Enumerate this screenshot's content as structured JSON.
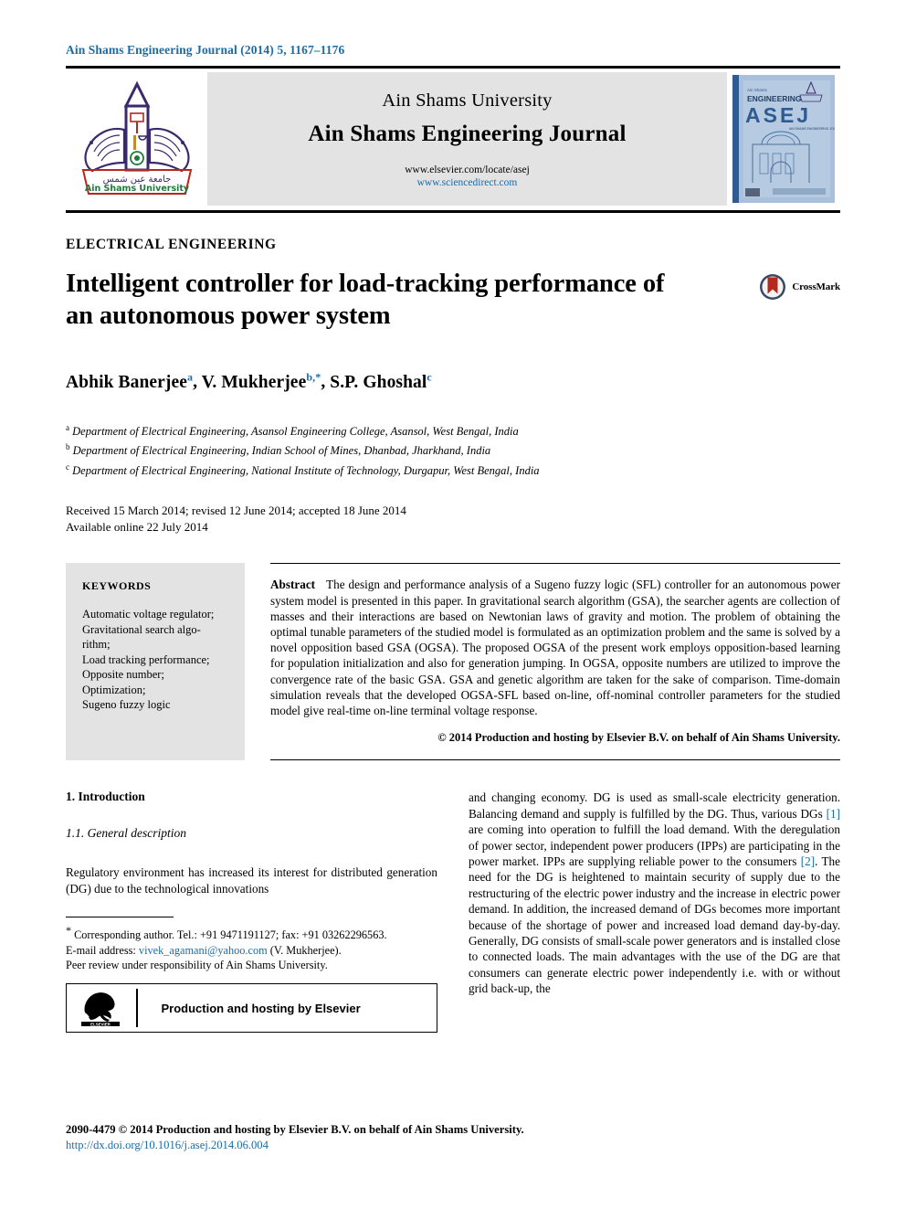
{
  "running_head": "Ain Shams Engineering Journal (2014) 5, 1167–1176",
  "masthead": {
    "university": "Ain Shams University",
    "journal": "Ain Shams Engineering Journal",
    "url_locate": "www.elsevier.com/locate/asej",
    "url_sciencedirect": "www.sciencedirect.com",
    "logo_caption_arabic": "جامعة عين شمس",
    "logo_caption": "Ain Shams University",
    "cover": {
      "top_label": "Ain Shams",
      "subject": "ENGINEERING",
      "acronym": "ASEJ",
      "acronym_sub": "AIN SHAMS ENGINEERING JOURNAL"
    }
  },
  "article": {
    "section_label": "ELECTRICAL ENGINEERING",
    "title": "Intelligent controller for load-tracking performance of an autonomous power system",
    "crossmark_label": "CrossMark",
    "authors": [
      {
        "name": "Abhik Banerjee",
        "sup": "a",
        "sep": ", "
      },
      {
        "name": "V. Mukherjee",
        "sup": "b,*",
        "sep": ", "
      },
      {
        "name": "S.P. Ghoshal",
        "sup": "c",
        "sep": ""
      }
    ],
    "affiliations": [
      {
        "marker": "a",
        "text": "Department of Electrical Engineering, Asansol Engineering College, Asansol, West Bengal, India"
      },
      {
        "marker": "b",
        "text": "Department of Electrical Engineering, Indian School of Mines, Dhanbad, Jharkhand, India"
      },
      {
        "marker": "c",
        "text": "Department of Electrical Engineering, National Institute of Technology, Durgapur, West Bengal, India"
      }
    ],
    "history_line1": "Received 15 March 2014; revised 12 June 2014; accepted 18 June 2014",
    "history_line2": "Available online 22 July 2014"
  },
  "keywords": {
    "heading": "KEYWORDS",
    "items": [
      "Automatic voltage regulator;",
      "Gravitational search algo-",
      "rithm;",
      "Load tracking performance;",
      "Opposite number;",
      "Optimization;",
      "Sugeno fuzzy logic"
    ]
  },
  "abstract": {
    "heading": "Abstract",
    "text": "The design and performance analysis of a Sugeno fuzzy logic (SFL) controller for an autonomous power system model is presented in this paper. In gravitational search algorithm (GSA), the searcher agents are collection of masses and their interactions are based on Newtonian laws of gravity and motion. The problem of obtaining the optimal tunable parameters of the studied model is formulated as an optimization problem and the same is solved by a novel opposition based GSA (OGSA). The proposed OGSA of the present work employs opposition-based learning for population initialization and also for generation jumping. In OGSA, opposite numbers are utilized to improve the convergence rate of the basic GSA. GSA and genetic algorithm are taken for the sake of comparison. Time-domain simulation reveals that the developed OGSA-SFL based on-line, off-nominal controller parameters for the studied model give real-time on-line terminal voltage response.",
    "copyright": "© 2014 Production and hosting by Elsevier B.V. on behalf of Ain Shams University."
  },
  "body": {
    "heading1": "1. Introduction",
    "heading2": "1.1. General description",
    "left_para": "Regulatory environment has increased its interest for distributed generation (DG) due to the technological innovations",
    "right_para_1": "and changing economy. DG is used as small-scale electricity generation. Balancing demand and supply is fulfilled by the DG. Thus, various DGs ",
    "right_ref_1": "[1]",
    "right_para_2": " are coming into operation to fulfill the load demand. With the deregulation of power sector, independent power producers (IPPs) are participating in the power market. IPPs are supplying reliable power to the consumers ",
    "right_ref_2": "[2]",
    "right_para_3": ". The need for the DG is heightened to maintain security of supply due to the restructuring of the electric power industry and the increase in electric power demand. In addition, the increased demand of DGs becomes more important because of the shortage of power and increased load demand day-by-day. Generally, DG consists of small-scale power generators and is installed close to connected loads. The main advantages with the use of the DG are that consumers can generate electric power independently i.e. with or without grid back-up, the"
  },
  "footnote": {
    "star": "*",
    "corresponding": "Corresponding author. Tel.: +91 9471191127; fax: +91 03262296563.",
    "email_label": "E-mail address:",
    "email": "vivek_agamani@yahoo.com",
    "email_suffix": "(V. Mukherjee).",
    "peer_review": "Peer review under responsibility of Ain Shams University.",
    "elsevier_logo_text": "ELSEVIER",
    "elsevier_caption": "Production and hosting by Elsevier"
  },
  "colophon": {
    "line1": "2090-4479 © 2014 Production and hosting by Elsevier B.V. on behalf of Ain Shams University.",
    "doi": "http://dx.doi.org/10.1016/j.asej.2014.06.004"
  },
  "colors": {
    "link_blue": "#1a6ca8",
    "masthead_grey": "#e3e3e3",
    "logo_purple": "#3b2a6b",
    "logo_green": "#1f7a3d",
    "cover_blue": "#6e93c4",
    "crossmark_red": "#b5281e"
  }
}
